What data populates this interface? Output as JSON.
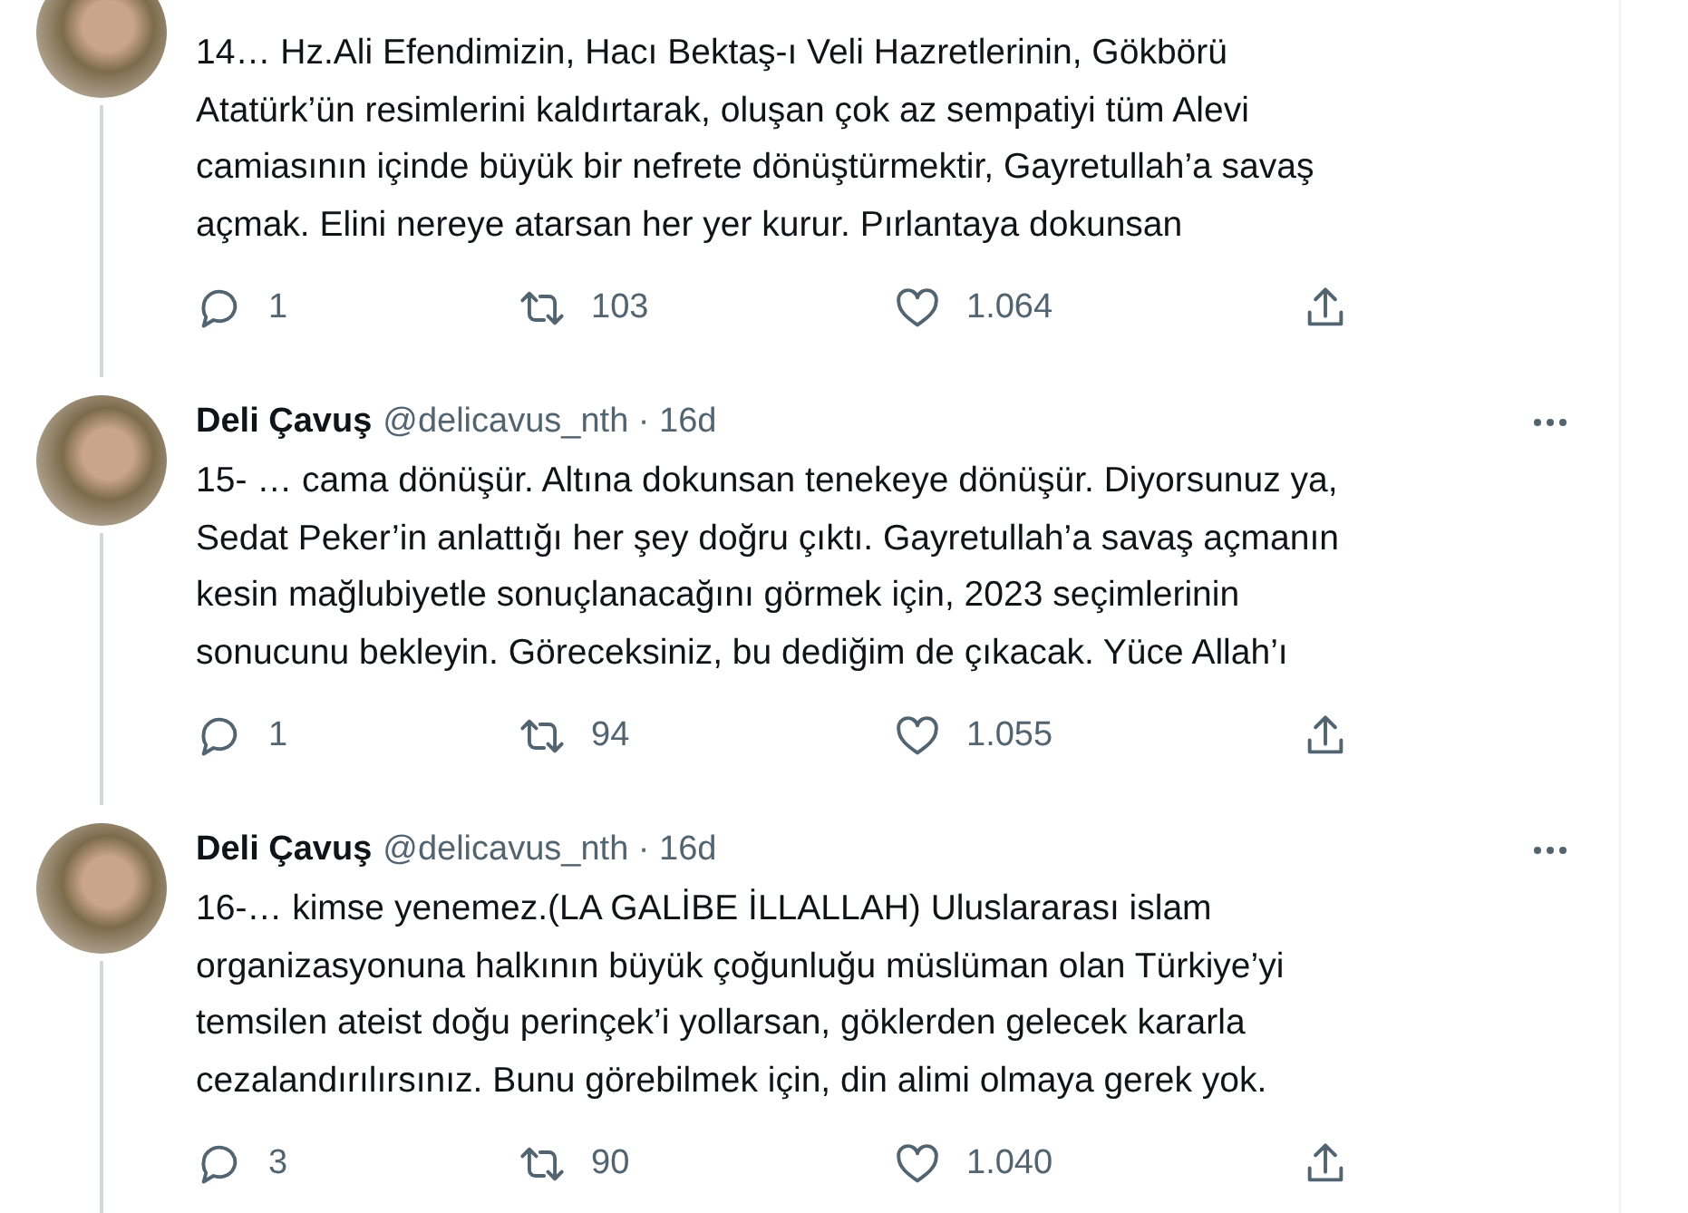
{
  "tweets": [
    {
      "text_lines": [
        "14… Hz.Ali Efendimizin, Hacı Bektaş-ı Veli Hazretlerinin, Gökbörü",
        "Atatürk’ün resimlerini kaldırtarak, oluşan çok az sempatiyi tüm Alevi",
        "camiasının içinde büyük bir nefrete dönüştürmektir, Gayretullah’a savaş",
        "açmak. Elini nereye atarsan her yer kurur. Pırlantaya dokunsan"
      ],
      "replies": "1",
      "retweets": "103",
      "likes": "1.064"
    },
    {
      "name": "Deli Çavuş",
      "handle": "@delicavus_nth",
      "separator": "·",
      "time": "16d",
      "text_lines": [
        "15- … cama dönüşür. Altına dokunsan tenekeye dönüşür. Diyorsunuz ya,",
        "Sedat Peker’in anlattığı her şey doğru çıktı. Gayretullah’a savaş açmanın",
        "kesin mağlubiyetle sonuçlanacağını görmek için, 2023 seçimlerinin",
        "sonucunu bekleyin. Göreceksiniz, bu dediğim de çıkacak. Yüce Allah’ı"
      ],
      "replies": "1",
      "retweets": "94",
      "likes": "1.055"
    },
    {
      "name": "Deli Çavuş",
      "handle": "@delicavus_nth",
      "separator": "·",
      "time": "16d",
      "text_lines": [
        "16-… kimse yenemez.(LA GALİBE İLLALLAH) Uluslararası islam",
        "organizasyonuna halkının büyük çoğunluğu müslüman olan Türkiye’yi",
        "temsilen ateist doğu perinçek’i yollarsan, göklerden gelecek kararla",
        "cezalandırılırsınız. Bunu görebilmek için, din alimi olmaya gerek yok."
      ],
      "replies": "3",
      "retweets": "90",
      "likes": "1.040"
    }
  ]
}
